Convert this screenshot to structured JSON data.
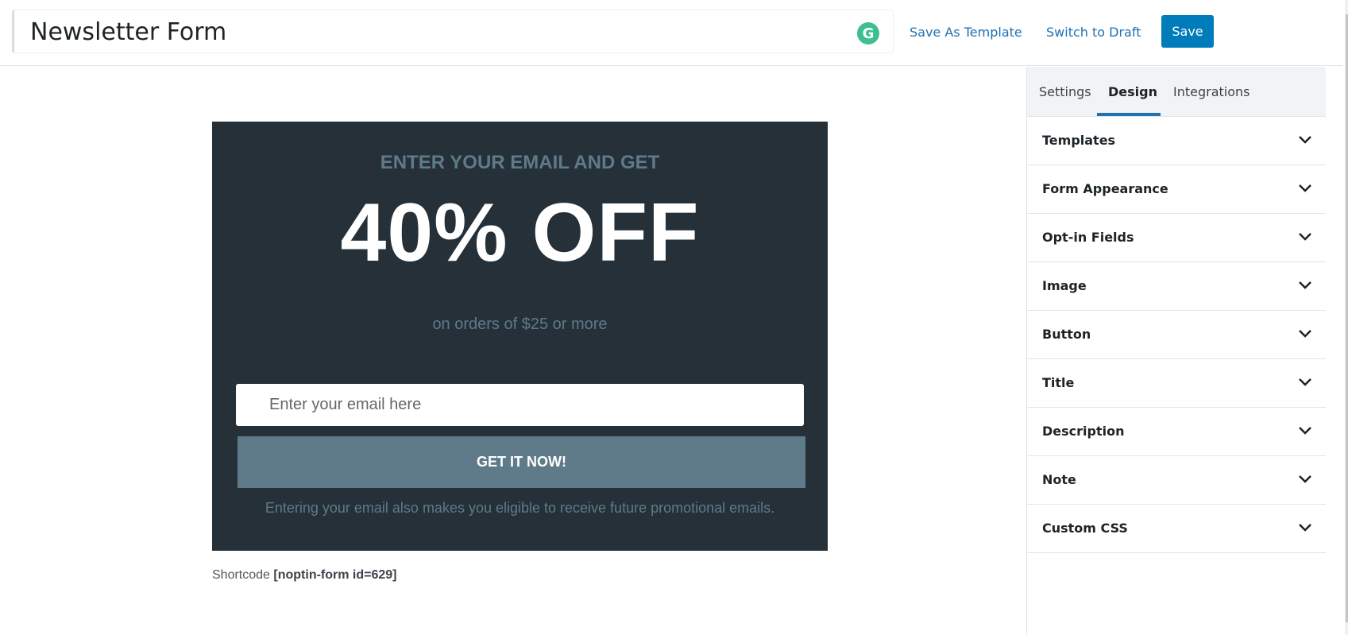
{
  "header": {
    "title_value": "Newsletter Form",
    "grammarly_icon": "grammarly-icon",
    "grammarly_glyph": "G",
    "save_as_template_label": "Save As Template",
    "switch_to_draft_label": "Switch to Draft",
    "save_label": "Save"
  },
  "preview": {
    "pre_title": "ENTER YOUR EMAIL AND GET",
    "title": "40% OFF",
    "description": "on orders of $25 or more",
    "email_placeholder": "Enter your email here",
    "button_label": "GET IT NOW!",
    "note": "Entering your email also makes you eligible to receive future promotional emails.",
    "colors": {
      "background": "#263038",
      "accent": "#5f7a88",
      "title": "#ffffff"
    }
  },
  "shortcode": {
    "label": "Shortcode",
    "value": "[noptin-form id=629]"
  },
  "sidebar": {
    "tabs": [
      {
        "label": "Settings",
        "active": false
      },
      {
        "label": "Design",
        "active": true
      },
      {
        "label": "Integrations",
        "active": false
      }
    ],
    "panels": [
      {
        "label": "Templates"
      },
      {
        "label": "Form Appearance"
      },
      {
        "label": "Opt-in Fields"
      },
      {
        "label": "Image"
      },
      {
        "label": "Button"
      },
      {
        "label": "Title"
      },
      {
        "label": "Description"
      },
      {
        "label": "Note"
      },
      {
        "label": "Custom CSS"
      }
    ]
  },
  "colors": {
    "primary": "#007cba",
    "link": "#2271b1",
    "grammarly": "#3dbf8f"
  }
}
